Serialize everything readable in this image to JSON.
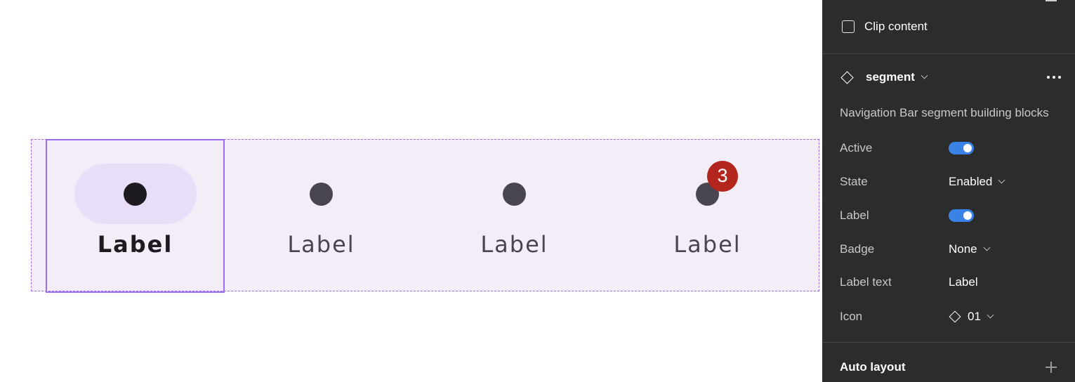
{
  "canvas": {
    "segments": [
      {
        "label": "Label",
        "active": true,
        "selected": true,
        "badge": ""
      },
      {
        "label": "Label",
        "active": false,
        "selected": false,
        "badge": ""
      },
      {
        "label": "Label",
        "active": false,
        "selected": false,
        "badge": ""
      },
      {
        "label": "Label",
        "active": false,
        "selected": false,
        "badge": "3"
      }
    ]
  },
  "panel": {
    "clip_content_label": "Clip content",
    "clip_content_checked": false,
    "component_name": "segment",
    "description": "Navigation Bar segment building blocks",
    "props": {
      "active": {
        "name": "Active",
        "value": true
      },
      "state": {
        "name": "State",
        "value": "Enabled"
      },
      "label": {
        "name": "Label",
        "value": true
      },
      "badge": {
        "name": "Badge",
        "value": "None"
      },
      "label_text": {
        "name": "Label text",
        "value": "Label"
      },
      "icon": {
        "name": "Icon",
        "value": "01"
      }
    },
    "auto_layout_title": "Auto layout"
  },
  "colors": {
    "accent": "#3b82e6",
    "selection": "#9b6ef3",
    "badge": "#b3261e",
    "active_indicator": "#e8def8",
    "frame_background": "#f3edf7"
  }
}
